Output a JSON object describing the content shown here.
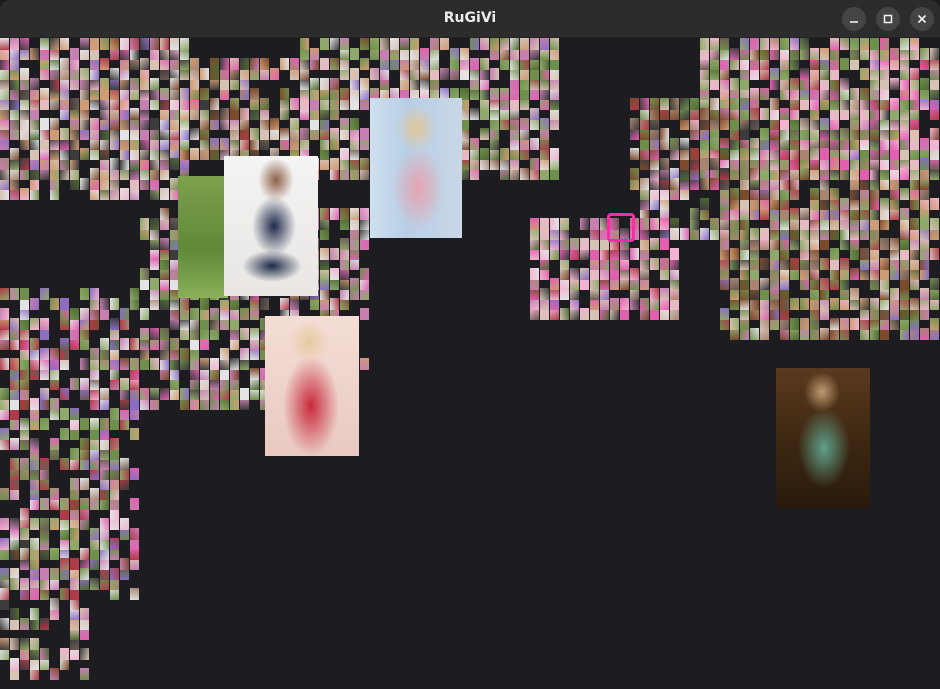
{
  "window": {
    "title": "RuGiVi",
    "buttons": {
      "minimize": "minimize-icon",
      "maximize": "maximize-icon",
      "close": "close-icon"
    }
  },
  "canvas": {
    "background": "#1d1c20",
    "selection_color": "#ff2aa8",
    "palette": [
      "#6f8f4c",
      "#8fa96a",
      "#c77fb2",
      "#e25fb0",
      "#a98570",
      "#7c4a2c",
      "#d7c2b4",
      "#e3e3e3",
      "#b03a48",
      "#8a6ec2",
      "#4e6b33",
      "#3b3b3b",
      "#cf9c73",
      "#f3b3d0",
      "#6b5b52"
    ]
  }
}
